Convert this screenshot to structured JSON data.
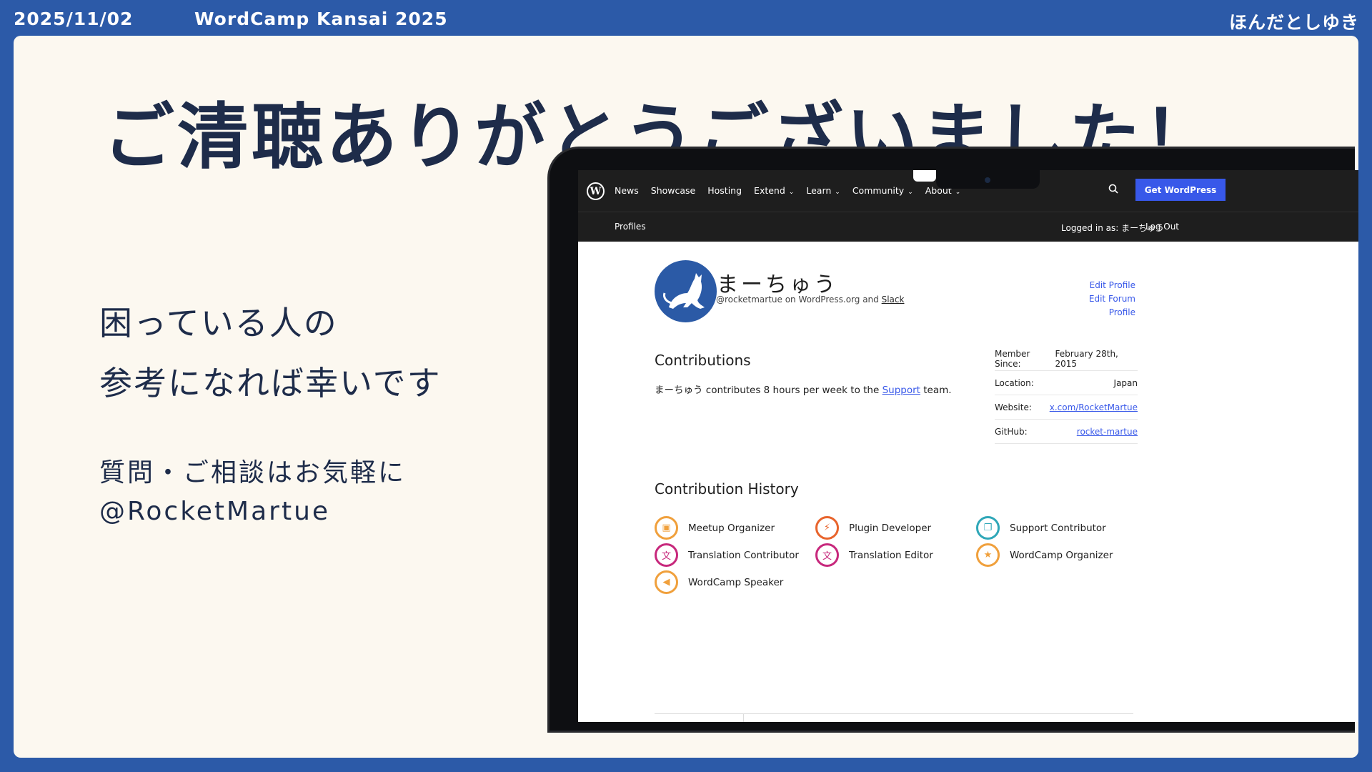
{
  "header": {
    "date": "2025/11/02",
    "event": "WordCamp Kansai 2025",
    "author": "ほんだとしゆき"
  },
  "slide": {
    "title": "ご清聴ありがとうございました！",
    "message_lines": [
      "困っている人の",
      "参考になれば幸いです"
    ],
    "contact_lines": [
      "質問・ご相談はお気軽に",
      "@RocketMartue"
    ]
  },
  "wp_nav": {
    "items": [
      {
        "label": "News",
        "dropdown": false
      },
      {
        "label": "Showcase",
        "dropdown": false
      },
      {
        "label": "Hosting",
        "dropdown": false
      },
      {
        "label": "Extend",
        "dropdown": true
      },
      {
        "label": "Learn",
        "dropdown": true
      },
      {
        "label": "Community",
        "dropdown": true
      },
      {
        "label": "About",
        "dropdown": true
      }
    ],
    "cta": "Get WordPress",
    "subnav_profiles": "Profiles",
    "logged_in": "Logged in as: まーちゅう",
    "logout": "Log Out"
  },
  "profile": {
    "name": "まーちゅう",
    "handle_prefix": "@rocketmartue on WordPress.org and",
    "handle_link": "Slack",
    "edit_profile": "Edit Profile",
    "edit_forum_profile": "Edit Forum Profile"
  },
  "contributions": {
    "heading": "Contributions",
    "text_before": "まーちゅう contributes 8 hours per week to the",
    "team_link": "Support",
    "text_after": "team."
  },
  "meta": [
    {
      "label": "Member Since:",
      "value": "February 28th, 2015",
      "link": false
    },
    {
      "label": "Location:",
      "value": "Japan",
      "link": false
    },
    {
      "label": "Website:",
      "value": "x.com/RocketMartue",
      "link": true
    },
    {
      "label": "GitHub:",
      "value": "rocket-martue",
      "link": true
    }
  ],
  "history": {
    "heading": "Contribution History",
    "badges": [
      {
        "label": "Meetup Organizer",
        "icon": "meetup-icon",
        "color": "#f0a03c"
      },
      {
        "label": "Plugin Developer",
        "icon": "plugin-icon",
        "color": "#e8642c"
      },
      {
        "label": "Support Contributor",
        "icon": "support-icon",
        "color": "#2fa7b8"
      },
      {
        "label": "Translation Contributor",
        "icon": "translation-icon",
        "color": "#c7287c"
      },
      {
        "label": "Translation Editor",
        "icon": "translation-editor-icon",
        "color": "#c7287c"
      },
      {
        "label": "WordCamp Organizer",
        "icon": "wordcamp-organizer-icon",
        "color": "#f0a03c"
      },
      {
        "label": "WordCamp Speaker",
        "icon": "speaker-icon",
        "color": "#f0a03c"
      }
    ]
  },
  "colors": {
    "frame_blue": "#2c5aa8",
    "slide_bg": "#fcf8f0",
    "title_text": "#1e2c4a",
    "wp_blue": "#3858e9"
  }
}
